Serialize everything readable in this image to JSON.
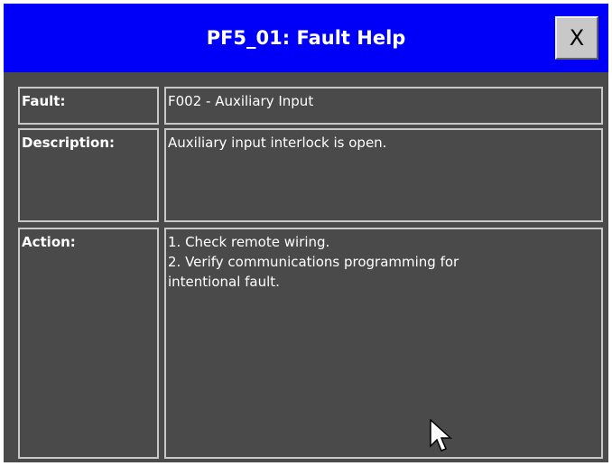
{
  "window": {
    "title": "PF5_01: Fault Help",
    "close_label": "X"
  },
  "fault": {
    "label": "Fault:",
    "value": "F002 - Auxiliary Input"
  },
  "description": {
    "label": "Description:",
    "value": "Auxiliary input interlock is open."
  },
  "action": {
    "label": "Action:",
    "lines": [
      "1. Check remote wiring.",
      "2. Verify communications programming for",
      "intentional fault."
    ]
  },
  "colors": {
    "titlebar": "#0000f8",
    "panel": "#4a4a4a",
    "text": "#ffffff",
    "border": "#c8c8c8"
  },
  "icons": {
    "cursor": "mouse-pointer-icon"
  }
}
